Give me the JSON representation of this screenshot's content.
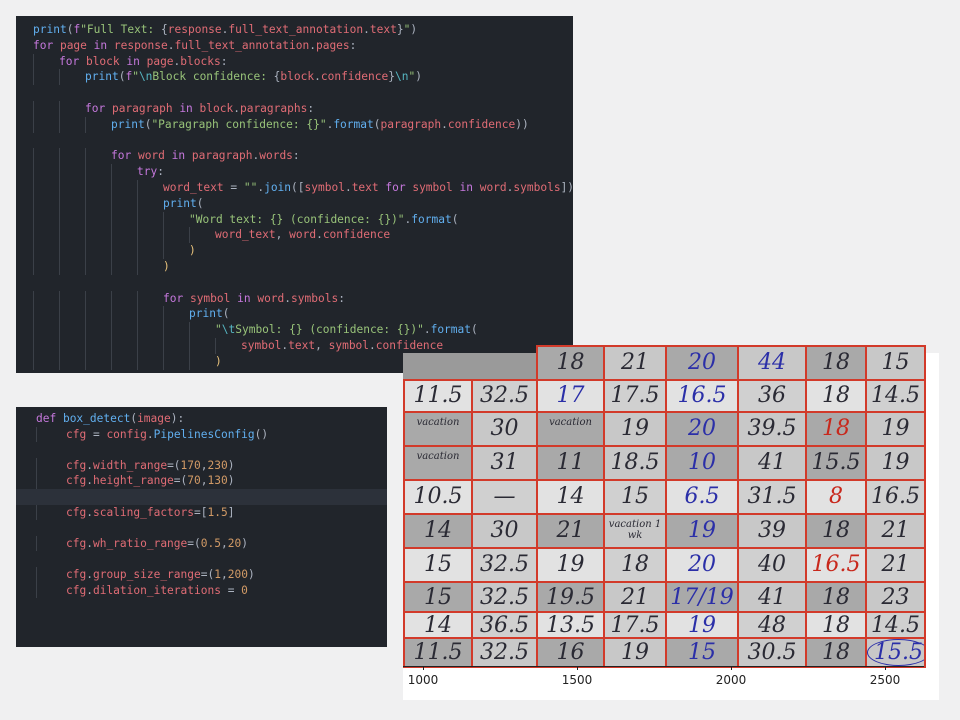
{
  "code_top": {
    "lines": [
      {
        "indent": 0,
        "tokens": [
          [
            "fn",
            "print"
          ],
          [
            "pl",
            "("
          ],
          [
            "kw",
            "f"
          ],
          [
            "str",
            "\"Full Text: "
          ],
          [
            "pl",
            "{"
          ],
          [
            "var",
            "response"
          ],
          [
            "pl",
            "."
          ],
          [
            "var",
            "full_text_annotation"
          ],
          [
            "pl",
            "."
          ],
          [
            "var",
            "text"
          ],
          [
            "pl",
            "}"
          ],
          [
            "str",
            "\""
          ],
          [
            "pl",
            ")"
          ]
        ]
      },
      {
        "indent": 0,
        "tokens": [
          [
            "kw",
            "for "
          ],
          [
            "var",
            "page"
          ],
          [
            "kw",
            " in "
          ],
          [
            "var",
            "response"
          ],
          [
            "pl",
            "."
          ],
          [
            "var",
            "full_text_annotation"
          ],
          [
            "pl",
            "."
          ],
          [
            "var",
            "pages"
          ],
          [
            "pl",
            ":"
          ]
        ]
      },
      {
        "indent": 1,
        "tokens": [
          [
            "kw",
            "for "
          ],
          [
            "var",
            "block"
          ],
          [
            "kw",
            " in "
          ],
          [
            "var",
            "page"
          ],
          [
            "pl",
            "."
          ],
          [
            "var",
            "blocks"
          ],
          [
            "pl",
            ":"
          ]
        ]
      },
      {
        "indent": 2,
        "tokens": [
          [
            "fn",
            "print"
          ],
          [
            "pl",
            "("
          ],
          [
            "kw",
            "f"
          ],
          [
            "str",
            "\""
          ],
          [
            "op",
            "\\n"
          ],
          [
            "str",
            "Block confidence: "
          ],
          [
            "pl",
            "{"
          ],
          [
            "var",
            "block"
          ],
          [
            "pl",
            "."
          ],
          [
            "var",
            "confidence"
          ],
          [
            "pl",
            "}"
          ],
          [
            "op",
            "\\n"
          ],
          [
            "str",
            "\""
          ],
          [
            "pl",
            ")"
          ]
        ]
      },
      {
        "indent": 0,
        "tokens": []
      },
      {
        "indent": 2,
        "tokens": [
          [
            "kw",
            "for "
          ],
          [
            "var",
            "paragraph"
          ],
          [
            "kw",
            " in "
          ],
          [
            "var",
            "block"
          ],
          [
            "pl",
            "."
          ],
          [
            "var",
            "paragraphs"
          ],
          [
            "pl",
            ":"
          ]
        ]
      },
      {
        "indent": 3,
        "tokens": [
          [
            "fn",
            "print"
          ],
          [
            "pl",
            "("
          ],
          [
            "str",
            "\"Paragraph confidence: {}\""
          ],
          [
            "pl",
            "."
          ],
          [
            "fn",
            "format"
          ],
          [
            "pl",
            "("
          ],
          [
            "var",
            "paragraph"
          ],
          [
            "pl",
            "."
          ],
          [
            "var",
            "confidence"
          ],
          [
            "pl",
            "))"
          ]
        ]
      },
      {
        "indent": 0,
        "tokens": []
      },
      {
        "indent": 3,
        "tokens": [
          [
            "kw",
            "for "
          ],
          [
            "var",
            "word"
          ],
          [
            "kw",
            " in "
          ],
          [
            "var",
            "paragraph"
          ],
          [
            "pl",
            "."
          ],
          [
            "var",
            "words"
          ],
          [
            "pl",
            ":"
          ]
        ]
      },
      {
        "indent": 4,
        "tokens": [
          [
            "kw",
            "try"
          ],
          [
            "pl",
            ":"
          ]
        ]
      },
      {
        "indent": 5,
        "tokens": [
          [
            "var",
            "word_text"
          ],
          [
            "pl",
            " = "
          ],
          [
            "str",
            "\"\""
          ],
          [
            "pl",
            "."
          ],
          [
            "fn",
            "join"
          ],
          [
            "pl",
            "(["
          ],
          [
            "var",
            "symbol"
          ],
          [
            "pl",
            "."
          ],
          [
            "var",
            "text"
          ],
          [
            "kw",
            " for "
          ],
          [
            "var",
            "symbol"
          ],
          [
            "kw",
            " in "
          ],
          [
            "var",
            "word"
          ],
          [
            "pl",
            "."
          ],
          [
            "var",
            "symbols"
          ],
          [
            "pl",
            "])"
          ]
        ]
      },
      {
        "indent": 5,
        "tokens": [
          [
            "fn",
            "print"
          ],
          [
            "pl",
            "("
          ]
        ]
      },
      {
        "indent": 6,
        "tokens": [
          [
            "str",
            "\"Word text: {} (confidence: {})\""
          ],
          [
            "pl",
            "."
          ],
          [
            "fn",
            "format"
          ],
          [
            "pl",
            "("
          ]
        ]
      },
      {
        "indent": 7,
        "tokens": [
          [
            "var",
            "word_text"
          ],
          [
            "pl",
            ", "
          ],
          [
            "var",
            "word"
          ],
          [
            "pl",
            "."
          ],
          [
            "var",
            "confidence"
          ]
        ]
      },
      {
        "indent": 6,
        "tokens": [
          [
            "br",
            ")"
          ]
        ]
      },
      {
        "indent": 5,
        "tokens": [
          [
            "br",
            ")"
          ]
        ]
      },
      {
        "indent": 0,
        "tokens": []
      },
      {
        "indent": 5,
        "tokens": [
          [
            "kw",
            "for "
          ],
          [
            "var",
            "symbol"
          ],
          [
            "kw",
            " in "
          ],
          [
            "var",
            "word"
          ],
          [
            "pl",
            "."
          ],
          [
            "var",
            "symbols"
          ],
          [
            "pl",
            ":"
          ]
        ]
      },
      {
        "indent": 6,
        "tokens": [
          [
            "fn",
            "print"
          ],
          [
            "pl",
            "("
          ]
        ]
      },
      {
        "indent": 7,
        "tokens": [
          [
            "str",
            "\""
          ],
          [
            "op",
            "\\t"
          ],
          [
            "str",
            "Symbol: {} (confidence: {})\""
          ],
          [
            "pl",
            "."
          ],
          [
            "fn",
            "format"
          ],
          [
            "pl",
            "("
          ]
        ]
      },
      {
        "indent": 8,
        "tokens": [
          [
            "var",
            "symbol"
          ],
          [
            "pl",
            "."
          ],
          [
            "var",
            "text"
          ],
          [
            "pl",
            ", "
          ],
          [
            "var",
            "symbol"
          ],
          [
            "pl",
            "."
          ],
          [
            "var",
            "confidence"
          ]
        ]
      },
      {
        "indent": 7,
        "tokens": [
          [
            "br",
            ")"
          ]
        ]
      }
    ]
  },
  "code_bottom": {
    "lines": [
      {
        "indent": 0,
        "tokens": [
          [
            "kw",
            "def "
          ],
          [
            "fn",
            "box_detect"
          ],
          [
            "pl",
            "("
          ],
          [
            "var",
            "image"
          ],
          [
            "pl",
            "):"
          ]
        ]
      },
      {
        "indent": 1,
        "tokens": [
          [
            "var",
            "cfg"
          ],
          [
            "pl",
            " = "
          ],
          [
            "var",
            "config"
          ],
          [
            "pl",
            "."
          ],
          [
            "fn",
            "PipelinesConfig"
          ],
          [
            "pl",
            "()"
          ]
        ]
      },
      {
        "indent": 0,
        "tokens": []
      },
      {
        "indent": 1,
        "tokens": [
          [
            "var",
            "cfg"
          ],
          [
            "pl",
            "."
          ],
          [
            "var",
            "width_range"
          ],
          [
            "pl",
            "=("
          ],
          [
            "num",
            "170"
          ],
          [
            "pl",
            ","
          ],
          [
            "num",
            "230"
          ],
          [
            "pl",
            ")"
          ]
        ]
      },
      {
        "indent": 1,
        "tokens": [
          [
            "var",
            "cfg"
          ],
          [
            "pl",
            "."
          ],
          [
            "var",
            "height_range"
          ],
          [
            "pl",
            "=("
          ],
          [
            "num",
            "70"
          ],
          [
            "pl",
            ","
          ],
          [
            "num",
            "130"
          ],
          [
            "pl",
            ")"
          ]
        ]
      },
      {
        "indent": 0,
        "tokens": [],
        "highlight": true
      },
      {
        "indent": 1,
        "tokens": [
          [
            "var",
            "cfg"
          ],
          [
            "pl",
            "."
          ],
          [
            "var",
            "scaling_factors"
          ],
          [
            "pl",
            "=["
          ],
          [
            "num",
            "1.5"
          ],
          [
            "pl",
            "]"
          ]
        ]
      },
      {
        "indent": 0,
        "tokens": []
      },
      {
        "indent": 1,
        "tokens": [
          [
            "var",
            "cfg"
          ],
          [
            "pl",
            "."
          ],
          [
            "var",
            "wh_ratio_range"
          ],
          [
            "pl",
            "=("
          ],
          [
            "num",
            "0.5"
          ],
          [
            "pl",
            ","
          ],
          [
            "num",
            "20"
          ],
          [
            "pl",
            ")"
          ]
        ]
      },
      {
        "indent": 0,
        "tokens": []
      },
      {
        "indent": 1,
        "tokens": [
          [
            "var",
            "cfg"
          ],
          [
            "pl",
            "."
          ],
          [
            "var",
            "group_size_range"
          ],
          [
            "pl",
            "=("
          ],
          [
            "num",
            "1"
          ],
          [
            "pl",
            ","
          ],
          [
            "num",
            "200"
          ],
          [
            "pl",
            ")"
          ]
        ]
      },
      {
        "indent": 1,
        "tokens": [
          [
            "var",
            "cfg"
          ],
          [
            "pl",
            "."
          ],
          [
            "var",
            "dilation_iterations"
          ],
          [
            "pl",
            " = "
          ],
          [
            "num",
            "0"
          ]
        ]
      }
    ]
  },
  "sheet": {
    "rows": [
      [
        {
          "t": "18"
        },
        {
          "t": "21"
        },
        {
          "t": "20",
          "c": "blue"
        },
        {
          "t": "44",
          "c": "blue"
        },
        {
          "t": "18"
        },
        {
          "t": "15"
        }
      ],
      [
        {
          "t": "11.5"
        },
        {
          "t": "32.5"
        },
        {
          "t": "17",
          "c": "blue"
        },
        {
          "t": "17.5"
        },
        {
          "t": "16.5",
          "c": "blue"
        },
        {
          "t": "36"
        },
        {
          "t": "18"
        },
        {
          "t": "14.5"
        }
      ],
      [
        {
          "t": "vacation",
          "s": "small"
        },
        {
          "t": "30"
        },
        {
          "t": "vacation",
          "s": "small"
        },
        {
          "t": "19"
        },
        {
          "t": "20",
          "c": "blue"
        },
        {
          "t": "39.5"
        },
        {
          "t": "18",
          "c": "red"
        },
        {
          "t": "19"
        }
      ],
      [
        {
          "t": "vacation",
          "s": "small"
        },
        {
          "t": "31"
        },
        {
          "t": "11"
        },
        {
          "t": "18.5"
        },
        {
          "t": "10",
          "c": "blue"
        },
        {
          "t": "41"
        },
        {
          "t": "15.5"
        },
        {
          "t": "19"
        }
      ],
      [
        {
          "t": "10.5"
        },
        {
          "t": "—"
        },
        {
          "t": "14"
        },
        {
          "t": "15"
        },
        {
          "t": "6.5",
          "c": "blue"
        },
        {
          "t": "31.5"
        },
        {
          "t": "8",
          "c": "red"
        },
        {
          "t": "16.5"
        }
      ],
      [
        {
          "t": "14"
        },
        {
          "t": "30"
        },
        {
          "t": "21"
        },
        {
          "t": "vacation 1 wk",
          "s": "small"
        },
        {
          "t": "19",
          "c": "blue"
        },
        {
          "t": "39"
        },
        {
          "t": "18"
        },
        {
          "t": "21"
        }
      ],
      [
        {
          "t": "15"
        },
        {
          "t": "32.5"
        },
        {
          "t": "19"
        },
        {
          "t": "18"
        },
        {
          "t": "20",
          "c": "blue"
        },
        {
          "t": "40"
        },
        {
          "t": "16.5",
          "c": "red"
        },
        {
          "t": "21"
        }
      ],
      [
        {
          "t": "15"
        },
        {
          "t": "32.5"
        },
        {
          "t": "19.5"
        },
        {
          "t": "21"
        },
        {
          "t": "17/19",
          "c": "blue"
        },
        {
          "t": "41"
        },
        {
          "t": "18"
        },
        {
          "t": "23"
        }
      ],
      [
        {
          "t": "14"
        },
        {
          "t": "36.5"
        },
        {
          "t": "13.5"
        },
        {
          "t": "17.5"
        },
        {
          "t": "19",
          "c": "blue"
        },
        {
          "t": "48"
        },
        {
          "t": "18"
        },
        {
          "t": "14.5"
        }
      ],
      [
        {
          "t": "11.5"
        },
        {
          "t": "32.5"
        },
        {
          "t": "16"
        },
        {
          "t": "19"
        },
        {
          "t": "15",
          "c": "blue"
        },
        {
          "t": "30.5"
        },
        {
          "t": "18"
        },
        {
          "t": "15.5",
          "c": "blue",
          "circled": true
        }
      ]
    ],
    "x_ticks": [
      "1000",
      "1500",
      "2000",
      "2500"
    ],
    "colors": {
      "grid": "#d23a2a",
      "dark": "#9a9a9a",
      "light": "#d9d9d9",
      "ink": "#2a2a34",
      "blue_ink": "#2b2fa8"
    }
  }
}
